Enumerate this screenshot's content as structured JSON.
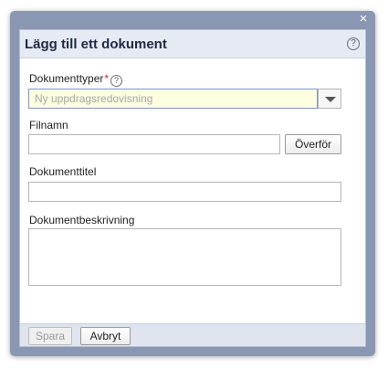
{
  "dialog": {
    "title": "Lägg till ett dokument",
    "close_glyph": "×",
    "help_glyph": "?"
  },
  "form": {
    "doc_types": {
      "label": "Dokumenttyper",
      "required_mark": "*",
      "help_glyph": "?",
      "placeholder": "Ny uppdragsredovisning",
      "value": ""
    },
    "filename": {
      "label": "Filnamn",
      "value": "",
      "upload_label": "Överför"
    },
    "doc_title": {
      "label": "Dokumenttitel",
      "value": ""
    },
    "doc_description": {
      "label": "Dokumentbeskrivning",
      "value": ""
    }
  },
  "footer": {
    "save_label": "Spara",
    "cancel_label": "Avbryt"
  },
  "icons": {
    "close": "close-icon",
    "help": "help-icon",
    "dropdown": "chevron-down-icon"
  },
  "colors": {
    "frame": "#8a97b2",
    "header_bg": "#e6eaf3",
    "active_field_bg": "#fdfde0",
    "active_field_border": "#7c99c4",
    "required": "#d11e1e"
  }
}
